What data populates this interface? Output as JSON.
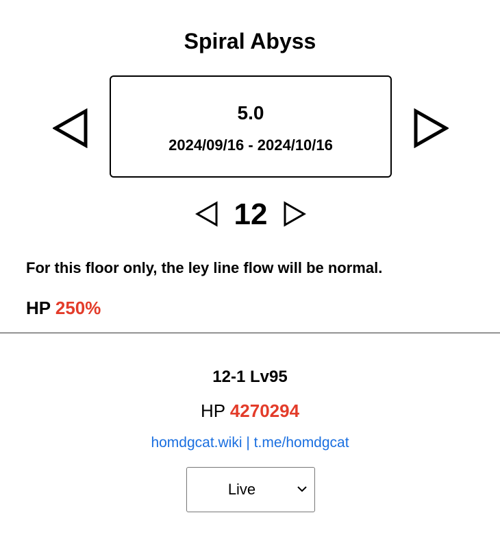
{
  "title": "Spiral Abyss",
  "version": {
    "number": "5.0",
    "dates": "2024/09/16 - 2024/10/16"
  },
  "floor": {
    "number": "12",
    "ley_line_text": "For this floor only, the ley line flow will be normal.",
    "hp_label": "HP",
    "hp_value": "250%"
  },
  "chamber": {
    "title": "12-1 Lv95",
    "hp_label": "HP",
    "hp_value": "4270294"
  },
  "links": {
    "wiki": "homdgcat.wiki",
    "separator": "|",
    "telegram": "t.me/homdgcat"
  },
  "server_select": {
    "selected": "Live"
  },
  "colors": {
    "accent_red": "#e33c2a",
    "link_blue": "#1a6fe0"
  },
  "icons": {
    "version_prev": "triangle-left-icon",
    "version_next": "triangle-right-icon",
    "floor_prev": "triangle-left-icon",
    "floor_next": "triangle-right-icon",
    "select": "chevron-down-icon"
  }
}
